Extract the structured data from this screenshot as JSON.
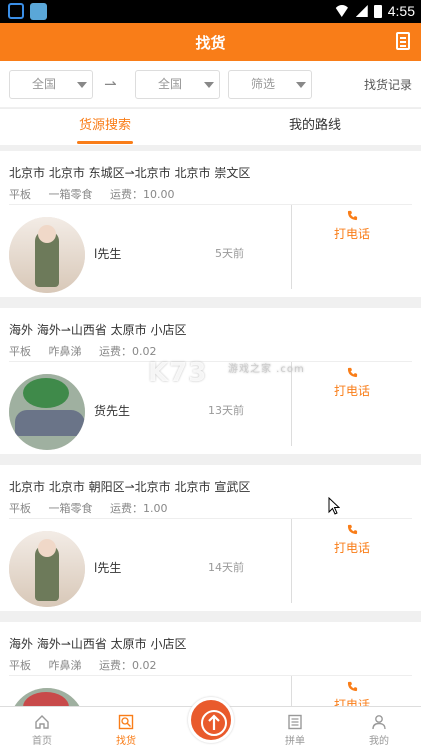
{
  "status_bar": {
    "time": "4:55"
  },
  "header": {
    "title": "找货",
    "icon": "document-icon"
  },
  "filters": {
    "from": "全国",
    "to": "全国",
    "filter": "筛选",
    "arrow": "⇀",
    "history": "找货记录"
  },
  "tabs": [
    {
      "label": "货源搜索",
      "active": true
    },
    {
      "label": "我的路线",
      "active": false
    }
  ],
  "listings": [
    {
      "route": "北京市 北京市 东城区⇀北京市 北京市 崇文区",
      "truck": "平板",
      "cargo": "一箱零食",
      "fee": "运费：10.00",
      "contact": "l先生",
      "time": "5天前",
      "call": "打电话"
    },
    {
      "route": "海外 海外⇀山西省 太原市 小店区",
      "truck": "平板",
      "cargo": "咋鼻涕",
      "fee": "运费：0.02",
      "contact": "货先生",
      "time": "13天前",
      "call": "打电话"
    },
    {
      "route": "北京市 北京市 朝阳区⇀北京市 北京市 宣武区",
      "truck": "平板",
      "cargo": "一箱零食",
      "fee": "运费：1.00",
      "contact": "l先生",
      "time": "14天前",
      "call": "打电话"
    },
    {
      "route": "海外 海外⇀山西省 太原市 小店区",
      "truck": "平板",
      "cargo": "咋鼻涕",
      "fee": "运费：0.02",
      "contact": "",
      "time": "",
      "call": "打电话"
    }
  ],
  "watermark": {
    "text": "K73",
    "sub": "游戏之家 .com"
  },
  "bottom_nav": [
    {
      "label": "首页",
      "icon": "home-icon",
      "active": false
    },
    {
      "label": "找货",
      "icon": "search-goods-icon",
      "active": true
    },
    {
      "label": "",
      "icon": "publish-icon",
      "active": false
    },
    {
      "label": "拼单",
      "icon": "list-icon",
      "active": false
    },
    {
      "label": "我的",
      "icon": "user-icon",
      "active": false
    }
  ],
  "colors": {
    "accent": "#f97d18",
    "publish": "#e95a2c"
  }
}
